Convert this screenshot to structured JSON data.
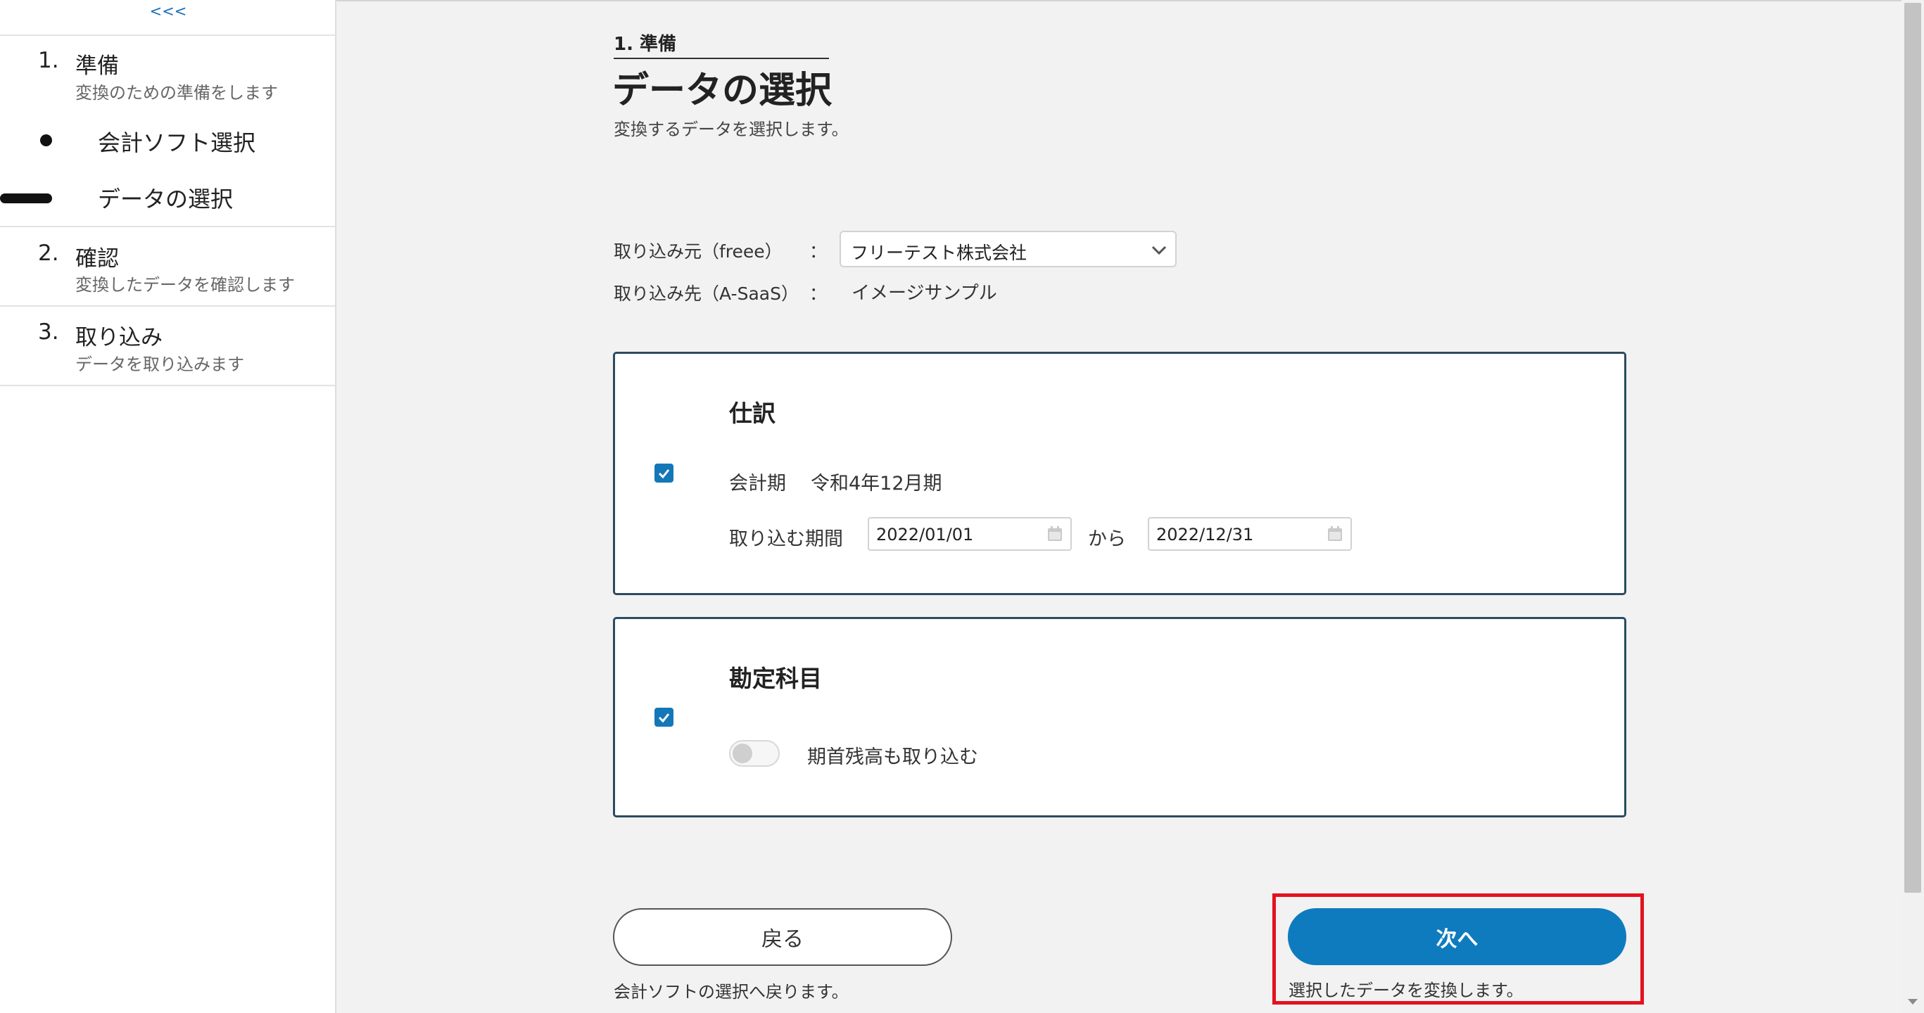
{
  "sidebar": {
    "collapse_label": "<<<",
    "steps": [
      {
        "num": "1.",
        "title": "準備",
        "subtitle": "変換のための準備をします"
      },
      {
        "num": "2.",
        "title": "確認",
        "subtitle": "変換したデータを確認します"
      },
      {
        "num": "3.",
        "title": "取り込み",
        "subtitle": "データを取り込みます"
      }
    ],
    "sub_items": [
      "会計ソフト選択",
      "データの選択"
    ]
  },
  "header": {
    "crumb": "1. 準備",
    "title": "データの選択",
    "description": "変換するデータを選択します。"
  },
  "source": {
    "label": "取り込み元（freee）",
    "colon": "：",
    "selected": "フリーテスト株式会社"
  },
  "destination": {
    "label": "取り込み先（A-SaaS）",
    "colon": "：",
    "value": "イメージサンプル"
  },
  "journal_card": {
    "title": "仕訳",
    "checked": true,
    "fiscal_label": "会計期",
    "fiscal_value": "令和4年12月期",
    "period_label": "取り込む期間",
    "date_from": "2022/01/01",
    "range_sep": "から",
    "date_to": "2022/12/31"
  },
  "accounts_card": {
    "title": "勘定科目",
    "checked": true,
    "toggle_on": false,
    "toggle_label": "期首残高も取り込む"
  },
  "footer": {
    "back_label": "戻る",
    "back_note": "会計ソフトの選択へ戻ります。",
    "next_label": "次へ",
    "next_note": "選択したデータを変換します。"
  },
  "colors": {
    "accent": "#0f7bbf",
    "card_border": "#2c4b62",
    "highlight": "#e3131e"
  }
}
